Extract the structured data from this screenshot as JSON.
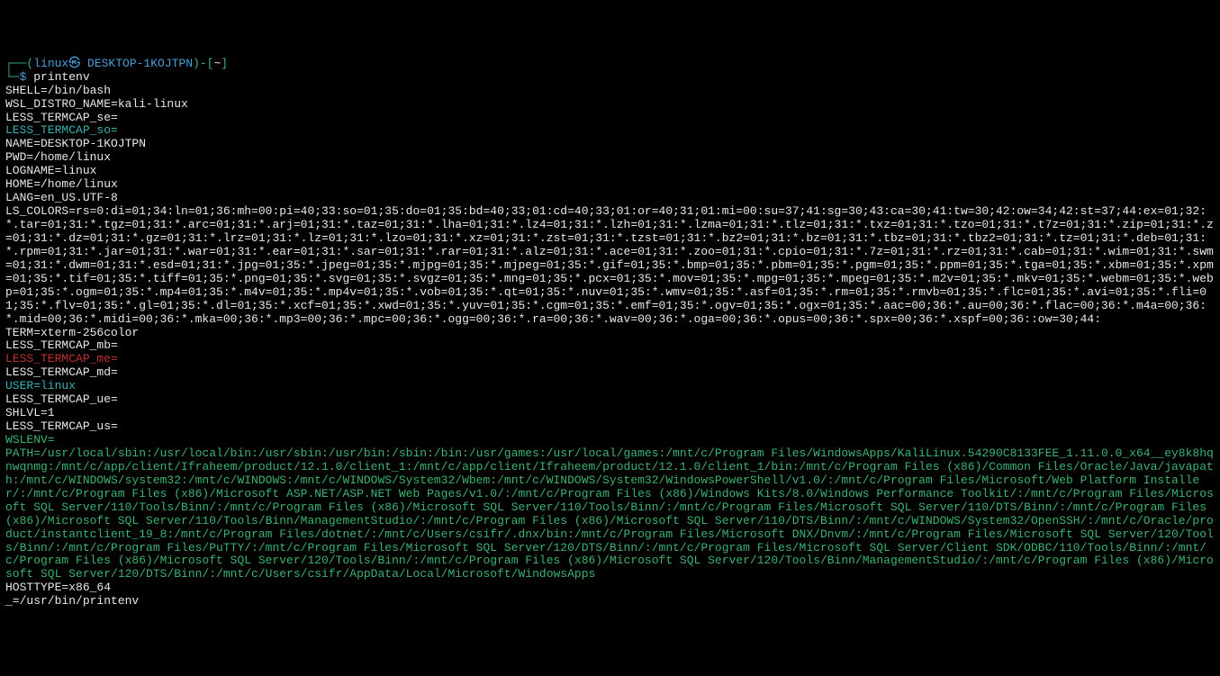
{
  "prompt": {
    "lbracket": "┌──(",
    "user_host": "linux㉿ DESKTOP-1KOJTPN",
    "rbracket": ")-[",
    "cwd": "~",
    "rbracket2": "]",
    "line2_prefix": "└─",
    "dollar": "$ ",
    "command": "printenv"
  },
  "env": {
    "SHELL": "SHELL=/bin/bash",
    "WSL_DISTRO": "WSL_DISTRO_NAME=kali-linux",
    "LESS_se": "LESS_TERMCAP_se=",
    "LESS_so": "LESS_TERMCAP_so=",
    "NAME": "NAME=DESKTOP-1KOJTPN",
    "PWD": "PWD=/home/linux",
    "LOGNAME": "LOGNAME=linux",
    "HOME": "HOME=/home/linux",
    "LANG": "LANG=en_US.UTF-8",
    "LSCOLORS": "LS_COLORS=rs=0:di=01;34:ln=01;36:mh=00:pi=40;33:so=01;35:do=01;35:bd=40;33;01:cd=40;33;01:or=40;31;01:mi=00:su=37;41:sg=30;43:ca=30;41:tw=30;42:ow=34;42:st=37;44:ex=01;32:*.tar=01;31:*.tgz=01;31:*.arc=01;31:*.arj=01;31:*.taz=01;31:*.lha=01;31:*.lz4=01;31:*.lzh=01;31:*.lzma=01;31:*.tlz=01;31:*.txz=01;31:*.tzo=01;31:*.t7z=01;31:*.zip=01;31:*.z=01;31:*.dz=01;31:*.gz=01;31:*.lrz=01;31:*.lz=01;31:*.lzo=01;31:*.xz=01;31:*.zst=01;31:*.tzst=01;31:*.bz2=01;31:*.bz=01;31:*.tbz=01;31:*.tbz2=01;31:*.tz=01;31:*.deb=01;31:*.rpm=01;31:*.jar=01;31:*.war=01;31:*.ear=01;31:*.sar=01;31:*.rar=01;31:*.alz=01;31:*.ace=01;31:*.zoo=01;31:*.cpio=01;31:*.7z=01;31:*.rz=01;31:*.cab=01;31:*.wim=01;31:*.swm=01;31:*.dwm=01;31:*.esd=01;31:*.jpg=01;35:*.jpeg=01;35:*.mjpg=01;35:*.mjpeg=01;35:*.gif=01;35:*.bmp=01;35:*.pbm=01;35:*.pgm=01;35:*.ppm=01;35:*.tga=01;35:*.xbm=01;35:*.xpm=01;35:*.tif=01;35:*.tiff=01;35:*.png=01;35:*.svg=01;35:*.svgz=01;35:*.mng=01;35:*.pcx=01;35:*.mov=01;35:*.mpg=01;35:*.mpeg=01;35:*.m2v=01;35:*.mkv=01;35:*.webm=01;35:*.webp=01;35:*.ogm=01;35:*.mp4=01;35:*.m4v=01;35:*.mp4v=01;35:*.vob=01;35:*.qt=01;35:*.nuv=01;35:*.wmv=01;35:*.asf=01;35:*.rm=01;35:*.rmvb=01;35:*.flc=01;35:*.avi=01;35:*.fli=01;35:*.flv=01;35:*.gl=01;35:*.dl=01;35:*.xcf=01;35:*.xwd=01;35:*.yuv=01;35:*.cgm=01;35:*.emf=01;35:*.ogv=01;35:*.ogx=01;35:*.aac=00;36:*.au=00;36:*.flac=00;36:*.m4a=00;36:*.mid=00;36:*.midi=00;36:*.mka=00;36:*.mp3=00;36:*.mpc=00;36:*.ogg=00;36:*.ra=00;36:*.wav=00;36:*.oga=00;36:*.opus=00;36:*.spx=00;36:*.xspf=00;36::ow=30;44:",
    "TERM": "TERM=xterm-256color",
    "LESS_mb": "LESS_TERMCAP_mb=",
    "LESS_me": "LESS_TERMCAP_me=",
    "LESS_md": "LESS_TERMCAP_md=",
    "USER": "USER=linux",
    "LESS_ue": "LESS_TERMCAP_ue=",
    "SHLVL": "SHLVL=1",
    "LESS_us": "LESS_TERMCAP_us=",
    "WSLENV": "WSLENV=",
    "PATH": "PATH=/usr/local/sbin:/usr/local/bin:/usr/sbin:/usr/bin:/sbin:/bin:/usr/games:/usr/local/games:/mnt/c/Program Files/WindowsApps/KaliLinux.54290C8133FEE_1.11.0.0_x64__ey8k8hqnwqnmg:/mnt/c/app/client/Ifraheem/product/12.1.0/client_1:/mnt/c/app/client/Ifraheem/product/12.1.0/client_1/bin:/mnt/c/Program Files (x86)/Common Files/Oracle/Java/javapath:/mnt/c/WINDOWS/system32:/mnt/c/WINDOWS:/mnt/c/WINDOWS/System32/Wbem:/mnt/c/WINDOWS/System32/WindowsPowerShell/v1.0/:/mnt/c/Program Files/Microsoft/Web Platform Installer/:/mnt/c/Program Files (x86)/Microsoft ASP.NET/ASP.NET Web Pages/v1.0/:/mnt/c/Program Files (x86)/Windows Kits/8.0/Windows Performance Toolkit/:/mnt/c/Program Files/Microsoft SQL Server/110/Tools/Binn/:/mnt/c/Program Files (x86)/Microsoft SQL Server/110/Tools/Binn/:/mnt/c/Program Files/Microsoft SQL Server/110/DTS/Binn/:/mnt/c/Program Files (x86)/Microsoft SQL Server/110/Tools/Binn/ManagementStudio/:/mnt/c/Program Files (x86)/Microsoft SQL Server/110/DTS/Binn/:/mnt/c/WINDOWS/System32/OpenSSH/:/mnt/c/Oracle/product/instantclient_19_8:/mnt/c/Program Files/dotnet/:/mnt/c/Users/csifr/.dnx/bin:/mnt/c/Program Files/Microsoft DNX/Dnvm/:/mnt/c/Program Files/Microsoft SQL Server/120/Tools/Binn/:/mnt/c/Program Files/PuTTY/:/mnt/c/Program Files/Microsoft SQL Server/120/DTS/Binn/:/mnt/c/Program Files/Microsoft SQL Server/Client SDK/ODBC/110/Tools/Binn/:/mnt/c/Program Files (x86)/Microsoft SQL Server/120/Tools/Binn/:/mnt/c/Program Files (x86)/Microsoft SQL Server/120/Tools/Binn/ManagementStudio/:/mnt/c/Program Files (x86)/Microsoft SQL Server/120/DTS/Binn/:/mnt/c/Users/csifr/AppData/Local/Microsoft/WindowsApps",
    "HOSTTYPE": "HOSTTYPE=x86_64",
    "UNDERSCORE": "_=/usr/bin/printenv"
  }
}
